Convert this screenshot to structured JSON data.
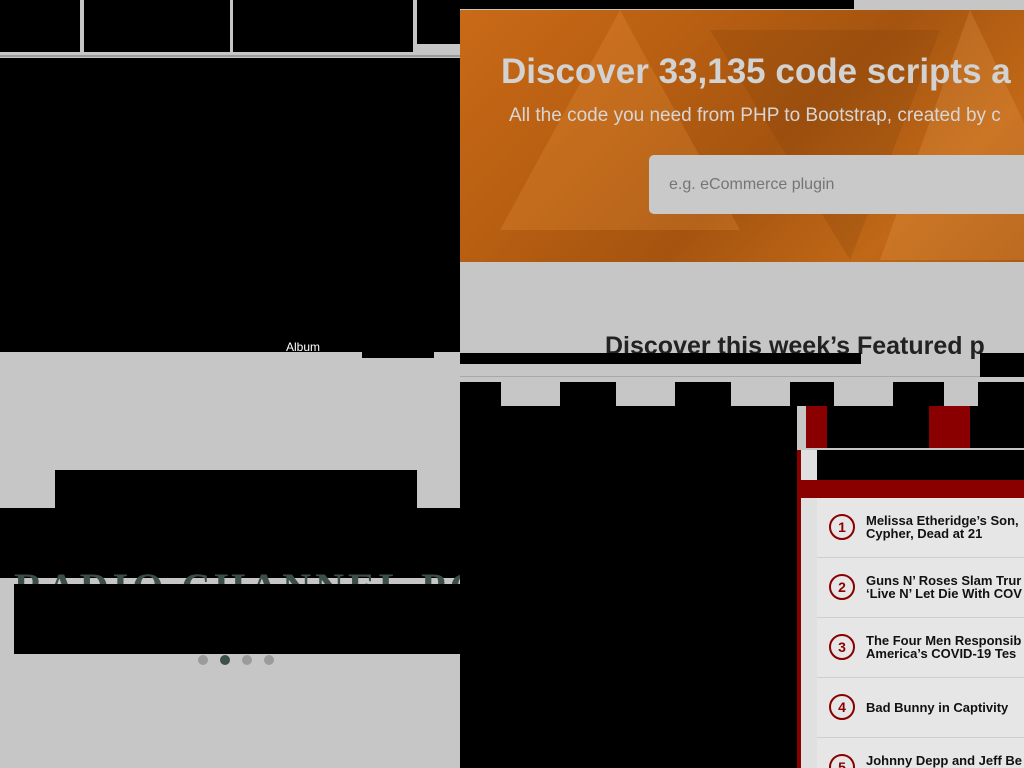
{
  "left_window": {
    "stray_label": "Album",
    "behind_text": "RADIO CHANNEL PODCAST",
    "carousel": {
      "dot_count": 4,
      "active_index": 1
    }
  },
  "right_window": {
    "hero": {
      "title": "Discover 33,135 code scripts a",
      "subtitle": "All the code you need from PHP to Bootstrap, created by c",
      "search_placeholder": "e.g. eCommerce plugin",
      "search_value": ""
    },
    "section": {
      "title": "Discover this week’s Featured p"
    },
    "trending": [
      {
        "rank": "1",
        "title": "Melissa Etheridge’s Son,\nCypher, Dead at 21"
      },
      {
        "rank": "2",
        "title": "Guns N’ Roses Slam Trur\n‘Live N’ Let Die With COV"
      },
      {
        "rank": "3",
        "title": "The Four Men Responsib\nAmerica’s COVID-19 Tes"
      },
      {
        "rank": "4",
        "title": "Bad Bunny in Captivity"
      },
      {
        "rank": "5",
        "title": "Johnny Depp and Jeff Be\nThrough John Lennon’s I"
      }
    ]
  },
  "colors": {
    "page_bg": "#c6c6c6",
    "hero_orange": "#b85f12",
    "accent_red": "#8a0000",
    "carousel_active": "#3c4f48"
  }
}
